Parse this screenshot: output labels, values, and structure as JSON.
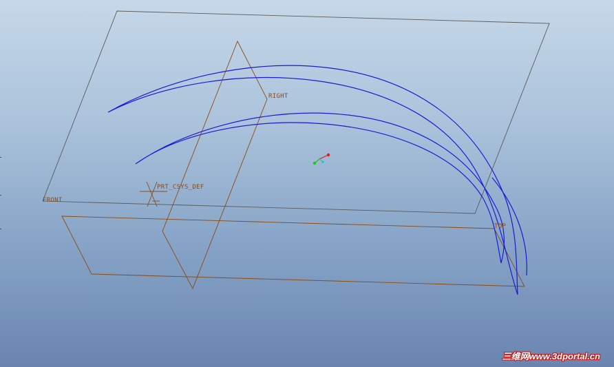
{
  "viewport": {
    "background_top": "#c6d8e8",
    "background_bottom": "#6985b0",
    "datum_color": "#8a4a16",
    "plane_outline_color": "#5a5a5a",
    "curve_color": "#1a1ad8"
  },
  "datum_planes": {
    "right_label": "RIGHT",
    "front_label": "FRONT",
    "top_label": "TOP"
  },
  "coordinate_system": {
    "label": "PRT_CSYS_DEF"
  },
  "view_triad": {
    "x_color": "#e01e1e",
    "y_color": "#1ec81e",
    "z_color": "#1ec8c8"
  },
  "watermark": {
    "text": "三维网www.3dportal.cn"
  }
}
